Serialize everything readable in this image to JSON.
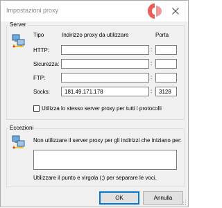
{
  "window": {
    "title": "Impostazioni proxy"
  },
  "watermark": {
    "icon": "chimera-revo-logo-icon"
  },
  "server": {
    "legend": "Server",
    "col_type": "Tipo",
    "col_address": "Indirizzo proxy da utilizzare",
    "col_port": "Porta",
    "rows": [
      {
        "label": "HTTP:",
        "address": "",
        "port": ""
      },
      {
        "label": "Sicurezza:",
        "address": "",
        "port": ""
      },
      {
        "label": "FTP:",
        "address": "",
        "port": ""
      },
      {
        "label": "Socks:",
        "address": "181.49.171.178",
        "port": "3128"
      }
    ],
    "colon": ":",
    "same_proxy_label": "Utilizza lo stesso server proxy per tutti i protocolli",
    "same_proxy_checked": false
  },
  "exceptions": {
    "legend": "Eccezioni",
    "desc": "Non utilizzare il server proxy per gli indirizzi che iniziano per:",
    "value": "",
    "hint": "Utilizzare il punto e virgola (;) per separare le voci."
  },
  "buttons": {
    "ok": "OK",
    "cancel": "Annulla"
  },
  "colors": {
    "accent": "#0078d7",
    "dialog_bg": "#f0f0f0",
    "watermark": "#e8413a"
  }
}
